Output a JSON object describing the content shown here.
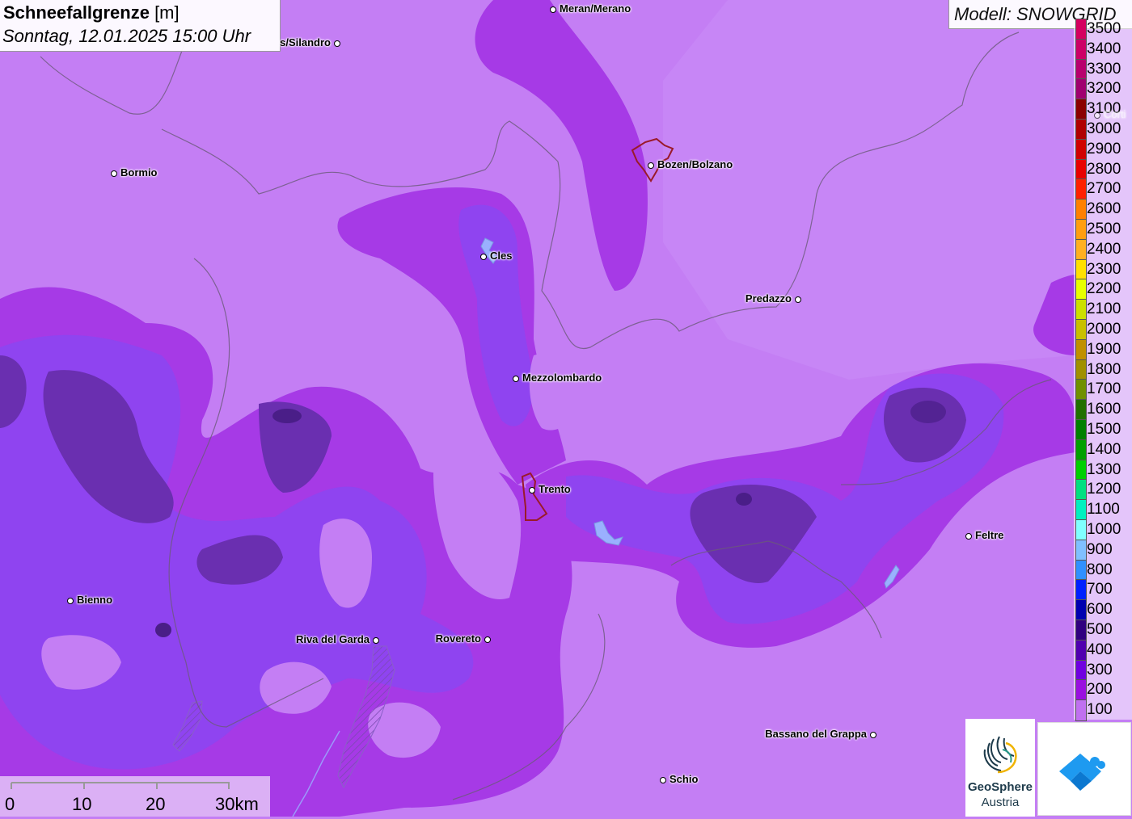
{
  "title": {
    "bold": "Schneefallgrenze",
    "unit": " [m]",
    "datetime": "Sonntag, 12.01.2025 15:00 Uhr"
  },
  "model": "Modell: SNOWGRID",
  "legend": [
    {
      "label": "3500",
      "color": "#d40060"
    },
    {
      "label": "3400",
      "color": "#cc0066"
    },
    {
      "label": "3300",
      "color": "#b8006e"
    },
    {
      "label": "3200",
      "color": "#a00070"
    },
    {
      "label": "3100",
      "color": "#8b0000"
    },
    {
      "label": "3000",
      "color": "#b00000"
    },
    {
      "label": "2900",
      "color": "#d00000"
    },
    {
      "label": "2800",
      "color": "#e80000"
    },
    {
      "label": "2700",
      "color": "#ff2000"
    },
    {
      "label": "2600",
      "color": "#ff8000"
    },
    {
      "label": "2500",
      "color": "#ff9e10"
    },
    {
      "label": "2400",
      "color": "#ffb020"
    },
    {
      "label": "2300",
      "color": "#ffe000"
    },
    {
      "label": "2200",
      "color": "#e8ff00"
    },
    {
      "label": "2100",
      "color": "#cce000"
    },
    {
      "label": "2000",
      "color": "#c8c000"
    },
    {
      "label": "1900",
      "color": "#c09000"
    },
    {
      "label": "1800",
      "color": "#a09000"
    },
    {
      "label": "1700",
      "color": "#709000"
    },
    {
      "label": "1600",
      "color": "#207000"
    },
    {
      "label": "1500",
      "color": "#008000"
    },
    {
      "label": "1400",
      "color": "#00a000"
    },
    {
      "label": "1300",
      "color": "#00d000"
    },
    {
      "label": "1200",
      "color": "#00e080"
    },
    {
      "label": "1100",
      "color": "#00f0c0"
    },
    {
      "label": "1000",
      "color": "#80ffff"
    },
    {
      "label": "900",
      "color": "#80c0ff"
    },
    {
      "label": "800",
      "color": "#3090ff"
    },
    {
      "label": "700",
      "color": "#0020ff"
    },
    {
      "label": "600",
      "color": "#0000b0"
    },
    {
      "label": "500",
      "color": "#300080"
    },
    {
      "label": "400",
      "color": "#5000b0"
    },
    {
      "label": "300",
      "color": "#7000e0"
    },
    {
      "label": "200",
      "color": "#9a10e0"
    },
    {
      "label": "100",
      "color": "#c070f0"
    }
  ],
  "cities": [
    {
      "name": "Meran/Merano",
      "side": "right"
    },
    {
      "name": "s/Silandro",
      "side": "left"
    },
    {
      "name": "Bormio",
      "side": "right"
    },
    {
      "name": "Bozen/Bolzano",
      "side": "right"
    },
    {
      "name": "Cles",
      "side": "right"
    },
    {
      "name": "Predazzo",
      "side": "left"
    },
    {
      "name": "Mezzolombardo",
      "side": "right"
    },
    {
      "name": "Trento",
      "side": "right"
    },
    {
      "name": "Feltre",
      "side": "right"
    },
    {
      "name": "Bienno",
      "side": "right"
    },
    {
      "name": "Riva del Garda",
      "side": "left"
    },
    {
      "name": "Rovereto",
      "side": "left"
    },
    {
      "name": "Bassano del Grappa",
      "side": "left"
    },
    {
      "name": "Schio",
      "side": "right"
    },
    {
      "name": "Corti",
      "side": "right"
    }
  ],
  "scale": {
    "labels": [
      "0",
      "10",
      "20",
      "30km"
    ]
  },
  "logos": {
    "geosphere_line1": "GeoSphere",
    "geosphere_line2": "Austria"
  }
}
